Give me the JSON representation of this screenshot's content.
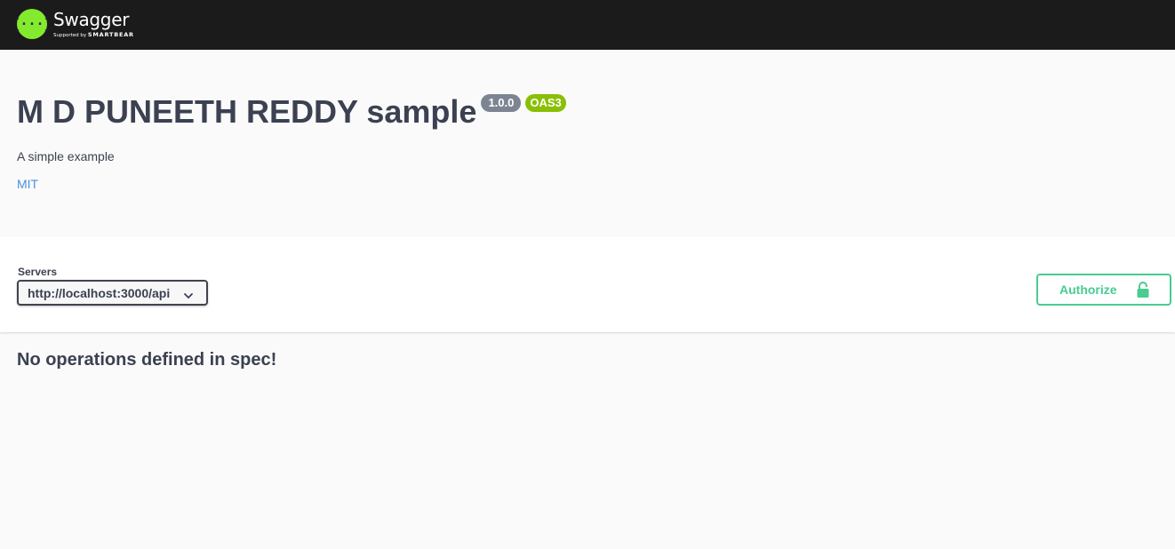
{
  "topbar": {
    "logo_word": "Swagger",
    "logo_sub_prefix": "Supported by",
    "logo_sub_brand": "SMARTBEAR",
    "logo_icon": "swagger-logo-icon"
  },
  "info": {
    "title": "M D PUNEETH REDDY sample",
    "version": "1.0.0",
    "spec_badge": "OAS3",
    "description": "A simple example",
    "license": "MIT"
  },
  "servers": {
    "label": "Servers",
    "selected": "http://localhost:3000/api",
    "chevron_icon": "chevron-down-icon"
  },
  "authorize": {
    "label": "Authorize",
    "icon": "unlocked-icon"
  },
  "operations": {
    "empty_message": "No operations defined in spec!"
  },
  "colors": {
    "topbar_bg": "#1b1b1b",
    "logo_green": "#85ea2d",
    "version_badge": "#7d8492",
    "oas_badge": "#89bf04",
    "authorize_green": "#49cc90",
    "link_blue": "#4990e2",
    "text": "#3b4151"
  }
}
